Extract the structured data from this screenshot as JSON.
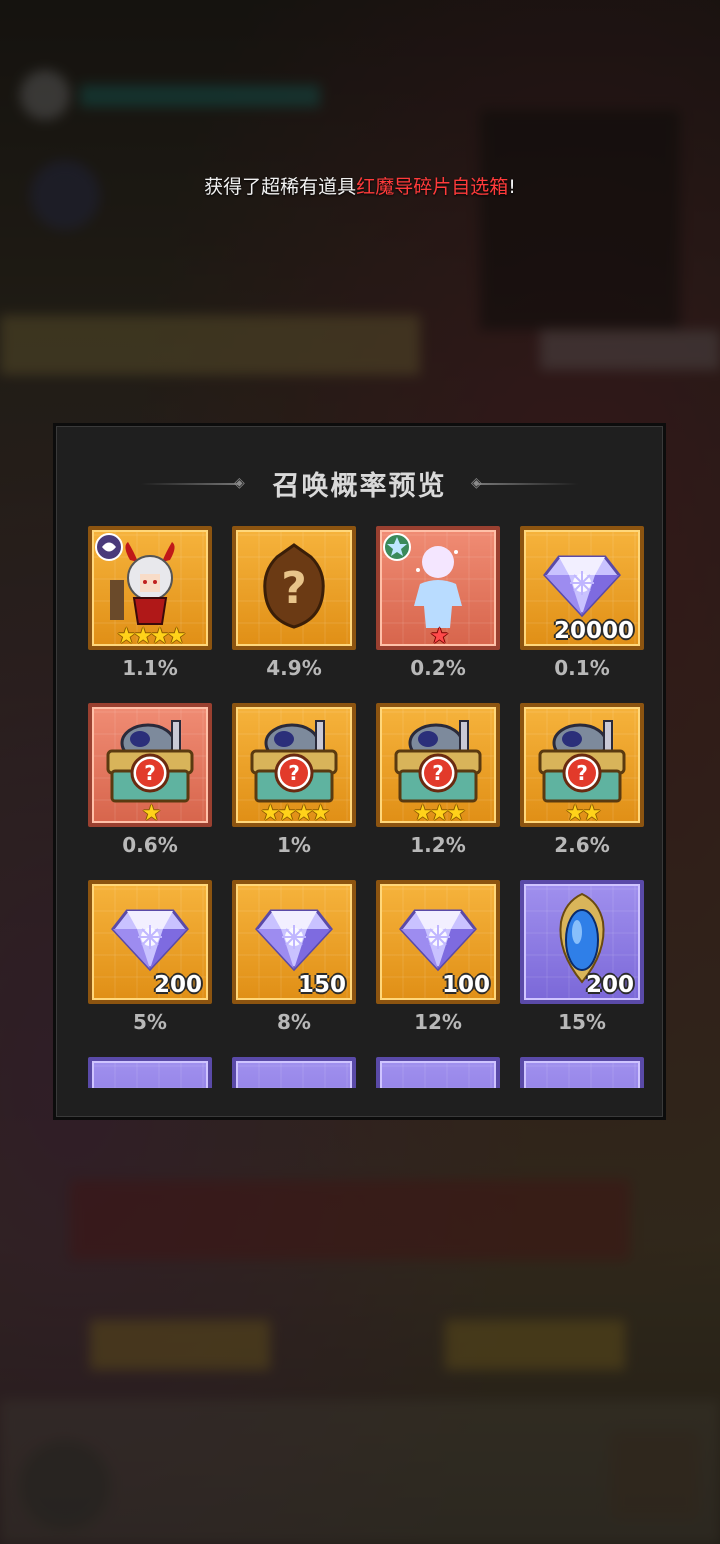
{
  "toast": {
    "prefix": "获得了超稀有道具",
    "item": "红魔导碎片自选箱",
    "suffix": "!"
  },
  "panel": {
    "title": "召唤概率预览"
  },
  "items": [
    {
      "name": "hero-red-demon",
      "pct": "1.1%",
      "qty": "",
      "stars": "★★★★",
      "bg": "gold"
    },
    {
      "name": "mystery-hero",
      "pct": "4.9%",
      "qty": "",
      "stars": "",
      "bg": "gold"
    },
    {
      "name": "hero-silhouette",
      "pct": "0.2%",
      "qty": "",
      "stars": "★",
      "bg": "red"
    },
    {
      "name": "diamond",
      "pct": "0.1%",
      "qty": "20000",
      "stars": "",
      "bg": "gold"
    },
    {
      "name": "chest-1star",
      "pct": "0.6%",
      "qty": "",
      "stars": "★",
      "bg": "red"
    },
    {
      "name": "chest-4star",
      "pct": "1%",
      "qty": "",
      "stars": "★★★★",
      "bg": "gold"
    },
    {
      "name": "chest-3star",
      "pct": "1.2%",
      "qty": "",
      "stars": "★★★",
      "bg": "gold"
    },
    {
      "name": "chest-2star",
      "pct": "2.6%",
      "qty": "",
      "stars": "★★",
      "bg": "gold"
    },
    {
      "name": "diamond",
      "pct": "5%",
      "qty": "200",
      "stars": "",
      "bg": "gold"
    },
    {
      "name": "diamond",
      "pct": "8%",
      "qty": "150",
      "stars": "",
      "bg": "gold"
    },
    {
      "name": "diamond",
      "pct": "12%",
      "qty": "100",
      "stars": "",
      "bg": "gold"
    },
    {
      "name": "blue-gem",
      "pct": "15%",
      "qty": "200",
      "stars": "",
      "bg": "purple"
    },
    {
      "name": "partial-item",
      "pct": "",
      "qty": "",
      "stars": "",
      "bg": "purple"
    },
    {
      "name": "partial-item",
      "pct": "",
      "qty": "",
      "stars": "",
      "bg": "purple"
    },
    {
      "name": "partial-item",
      "pct": "",
      "qty": "",
      "stars": "",
      "bg": "purple"
    },
    {
      "name": "partial-item",
      "pct": "",
      "qty": "",
      "stars": "",
      "bg": "purple"
    }
  ]
}
